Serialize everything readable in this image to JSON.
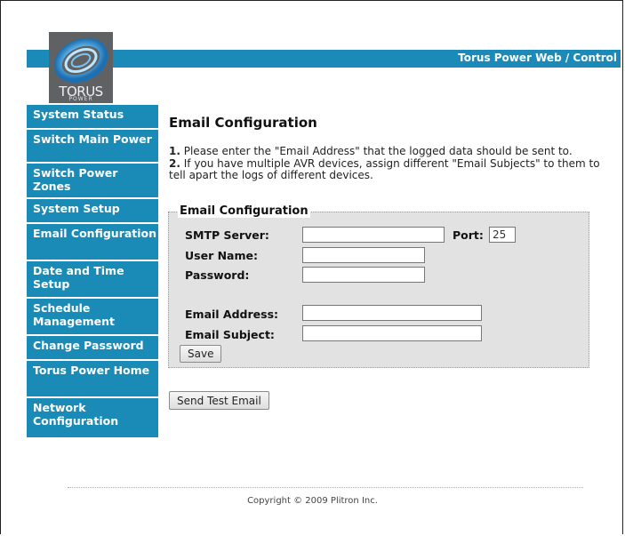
{
  "header": {
    "title": "Torus Power Web / Control",
    "logo_text": "TORUS",
    "logo_sub": "POWER"
  },
  "sidebar": {
    "items": [
      {
        "label": "System Status"
      },
      {
        "label": "Switch Main Power"
      },
      {
        "label": "Switch Power Zones"
      },
      {
        "label": "System Setup"
      },
      {
        "label": "Email Configuration"
      },
      {
        "label": "Date and Time Setup"
      },
      {
        "label": "Schedule Management"
      },
      {
        "label": "Change Password"
      },
      {
        "label": "Torus Power Home"
      },
      {
        "label": "Network Configuration"
      }
    ]
  },
  "main": {
    "title": "Email Configuration",
    "instructions": [
      {
        "num": "1.",
        "text": " Please enter the \"Email Address\" that the logged data should be sent to."
      },
      {
        "num": "2.",
        "text": " If you have multiple AVR devices, assign different \"Email Subjects\" to them to tell apart the logs of different devices."
      }
    ],
    "form": {
      "legend": "Email Configuration",
      "smtp_label": "SMTP Server:",
      "smtp_value": "",
      "port_label": "Port:",
      "port_value": "25",
      "username_label": "User Name:",
      "username_value": "",
      "password_label": "Password:",
      "password_value": "",
      "email_label": "Email Address:",
      "email_value": "",
      "subject_label": "Email Subject:",
      "subject_value": "",
      "save_label": "Save"
    },
    "test_button_label": "Send Test Email"
  },
  "footer": {
    "copyright": "Copyright © 2009 Plitron Inc."
  },
  "colors": {
    "accent": "#1a8ab7",
    "fieldset_bg": "#e2e2e2"
  }
}
